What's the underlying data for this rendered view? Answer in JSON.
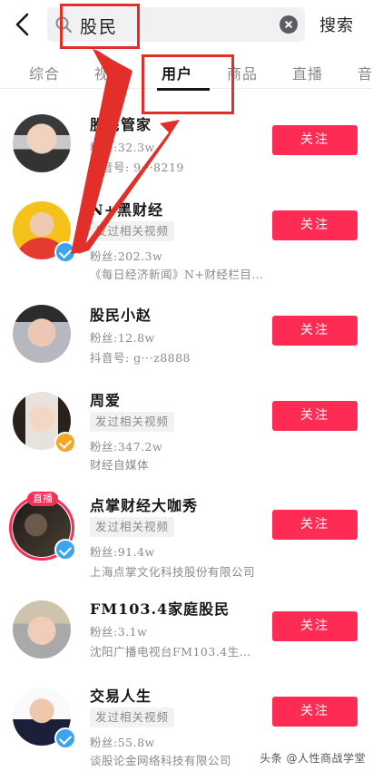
{
  "header": {
    "search_value": "股民",
    "search_button": "搜索"
  },
  "tabs": [
    {
      "label": "综合"
    },
    {
      "label": "视频"
    },
    {
      "label": "用户"
    },
    {
      "label": "商品"
    },
    {
      "label": "直播"
    },
    {
      "label": "音"
    }
  ],
  "users": [
    {
      "name": "股民管家",
      "fans": "粉丝:32.3w",
      "extra": "抖音号: 9···8219",
      "follow": "关注"
    },
    {
      "name": "N+黑财经",
      "tag": "发过相关视频",
      "fans": "粉丝:202.3w",
      "extra": "《每日经济新闻》N+财经栏目…",
      "follow": "关注"
    },
    {
      "name": "股民小赵",
      "fans": "粉丝:12.8w",
      "extra": "抖音号: g···z8888",
      "follow": "关注"
    },
    {
      "name": "周爱",
      "tag": "发过相关视频",
      "fans": "粉丝:347.2w",
      "extra": "财经自媒体",
      "follow": "关注"
    },
    {
      "name": "点掌财经大咖秀",
      "tag": "发过相关视频",
      "fans": "粉丝:91.4w",
      "extra": "上海点掌文化科技股份有限公司",
      "live": "直播",
      "follow": "关注"
    },
    {
      "name": "FM103.4家庭股民",
      "fans": "粉丝:3.1w",
      "extra": "沈阳广播电视台FM103.4生…",
      "follow": "关注"
    },
    {
      "name": "交易人生",
      "tag": "发过相关视频",
      "fans": "粉丝:55.8w",
      "extra": "谈股论金网络科技有限公司",
      "follow": "关注"
    }
  ],
  "watermark": "头条 @人性商战学堂",
  "icons": {
    "back": "chevron-left-icon",
    "search": "search-icon",
    "clear": "clear-icon",
    "verified": "verified-check-icon"
  },
  "colors": {
    "accent": "#fe2c55",
    "verified_blue": "#3aa4ef",
    "verified_gold": "#f5a623",
    "annotation": "#e22f2a"
  }
}
